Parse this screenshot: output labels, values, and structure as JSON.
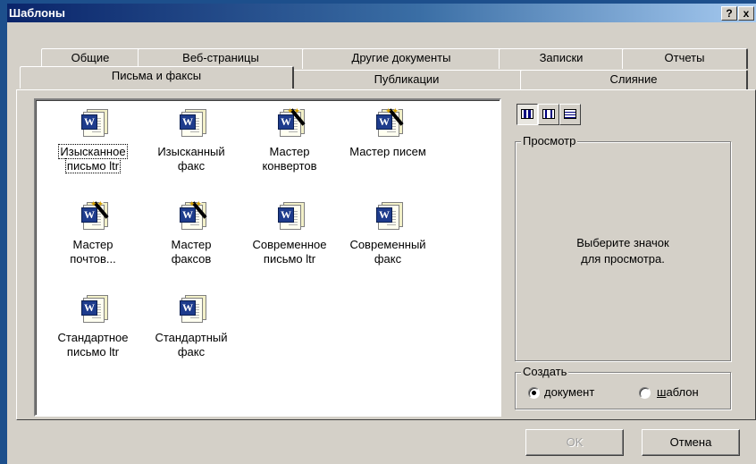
{
  "window": {
    "title": "Шаблоны",
    "help_label": "?",
    "close_label": "x"
  },
  "tabs_back": [
    "Общие",
    "Веб-страницы",
    "Другие документы",
    "Записки",
    "Отчеты"
  ],
  "tabs_front": [
    "Письма и факсы",
    "Публикации",
    "Слияние"
  ],
  "active_tab": "Письма и факсы",
  "templates": [
    {
      "line1": "Изысканное",
      "line2": "письмо ltr",
      "icon": "word-document-icon",
      "selected": true
    },
    {
      "line1": "Изысканный",
      "line2": "факс",
      "icon": "word-document-icon"
    },
    {
      "line1": "Мастер",
      "line2": "конвертов",
      "icon": "word-wizard-icon"
    },
    {
      "line1": "Мастер писем",
      "line2": "",
      "icon": "word-wizard-icon"
    },
    {
      "line1": "Мастер",
      "line2": "почтов...",
      "icon": "word-wizard-icon"
    },
    {
      "line1": "Мастер",
      "line2": "факсов",
      "icon": "word-wizard-icon"
    },
    {
      "line1": "Современное",
      "line2": "письмо ltr",
      "icon": "word-document-icon"
    },
    {
      "line1": "Современный",
      "line2": "факс",
      "icon": "word-document-icon"
    },
    {
      "line1": "Стандартное",
      "line2": "письмо ltr",
      "icon": "word-document-icon"
    },
    {
      "line1": "Стандартный",
      "line2": "факс",
      "icon": "word-document-icon"
    }
  ],
  "view_buttons": [
    "large-icons-view-icon",
    "list-view-icon",
    "details-view-icon"
  ],
  "preview": {
    "label": "Просмотр",
    "text_line1": "Выберите значок",
    "text_line2": "для просмотра."
  },
  "create": {
    "label": "Создать",
    "options": [
      {
        "pre": "",
        "accel": "д",
        "post": "окумент",
        "checked": true
      },
      {
        "pre": "",
        "accel": "ш",
        "post": "аблон",
        "checked": false
      }
    ]
  },
  "buttons": {
    "ok": "OK",
    "cancel": "Отмена"
  }
}
